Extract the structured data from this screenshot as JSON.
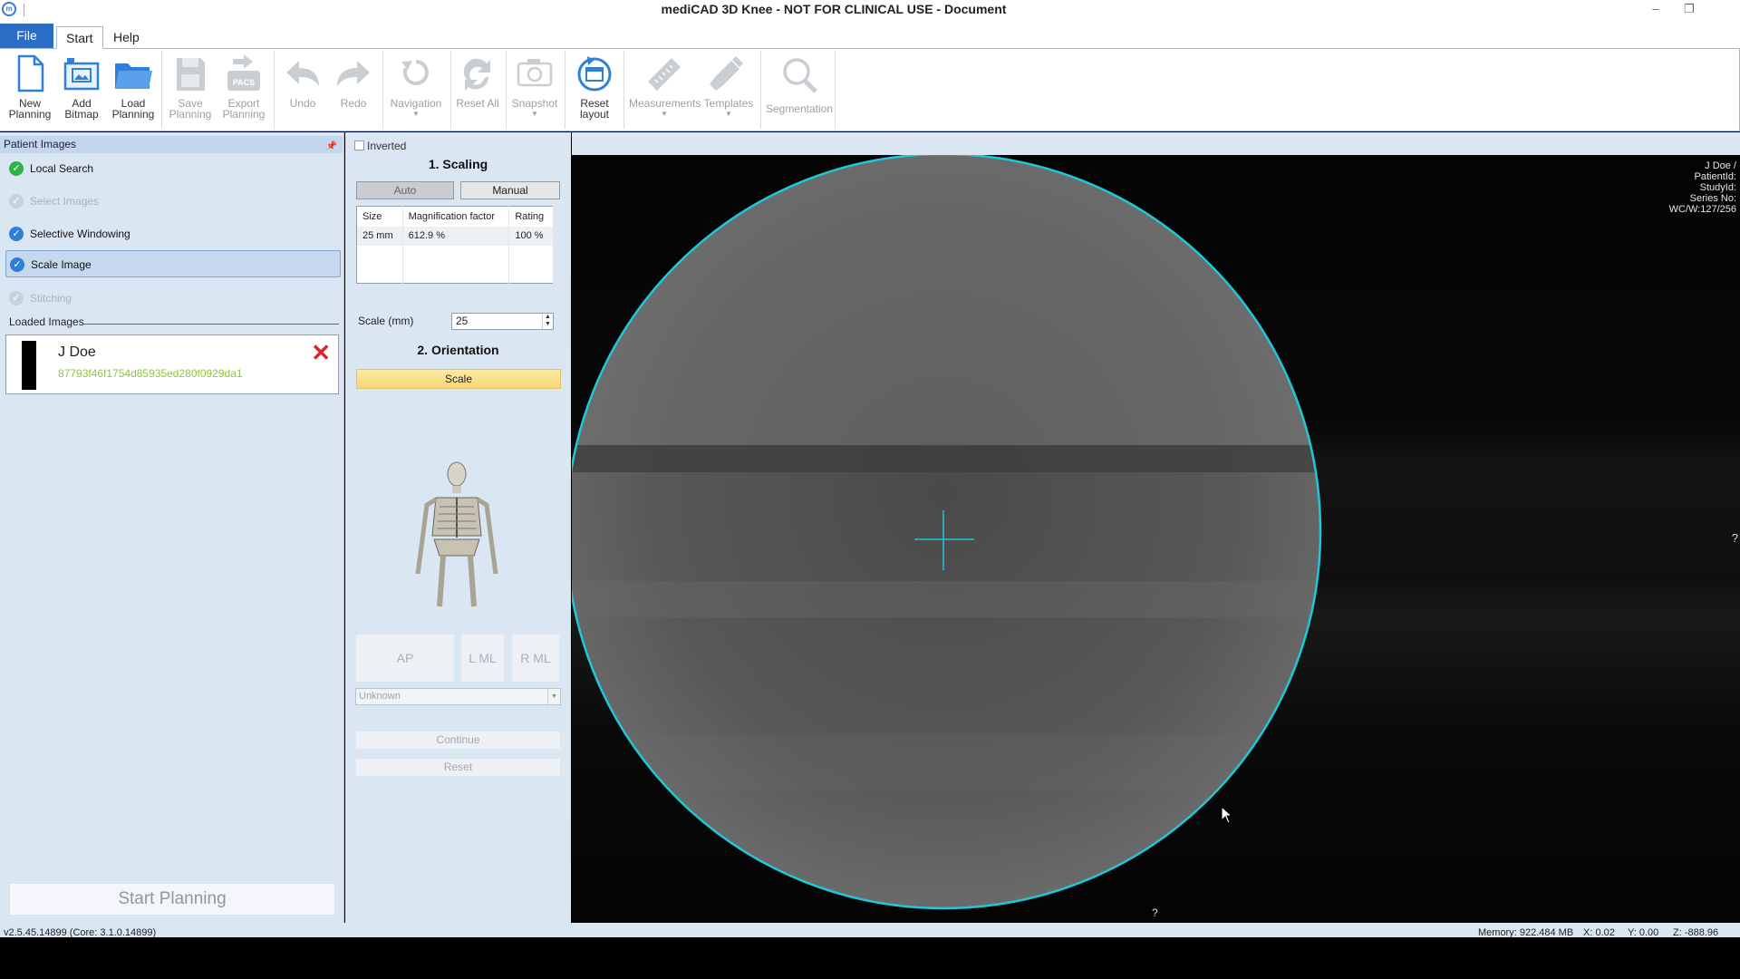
{
  "window": {
    "title": "mediCAD 3D Knee - NOT FOR CLINICAL USE - Document",
    "app_icon_label": "m"
  },
  "menu": {
    "file": "File",
    "tabs": [
      "Start",
      "Help"
    ]
  },
  "ribbon": {
    "buttons": [
      {
        "label1": "New",
        "label2": "Planning",
        "icon": "new-document-icon",
        "enabled": true
      },
      {
        "label1": "Add",
        "label2": "Bitmap",
        "icon": "add-bitmap-icon",
        "enabled": true
      },
      {
        "label1": "Load",
        "label2": "Planning",
        "icon": "folder-icon",
        "enabled": true
      },
      {
        "label1": "Save",
        "label2": "Planning",
        "icon": "save-icon",
        "enabled": false
      },
      {
        "label1": "Export",
        "label2": "Planning",
        "icon": "pacs-export-icon",
        "enabled": false
      },
      {
        "label1": "Undo",
        "label2": "",
        "icon": "undo-icon",
        "enabled": false
      },
      {
        "label1": "Redo",
        "label2": "",
        "icon": "redo-icon",
        "enabled": false
      },
      {
        "label1": "Navigation",
        "label2": "",
        "icon": "navigation-icon",
        "enabled": false
      },
      {
        "label1": "Reset All",
        "label2": "",
        "icon": "reset-all-icon",
        "enabled": false
      },
      {
        "label1": "Snapshot",
        "label2": "",
        "icon": "camera-icon",
        "enabled": false
      },
      {
        "label1": "Reset",
        "label2": "layout",
        "icon": "reset-layout-icon",
        "enabled": true
      },
      {
        "label1": "Measurements",
        "label2": "",
        "icon": "ruler-icon",
        "enabled": false
      },
      {
        "label1": "Templates",
        "label2": "",
        "icon": "implant-template-icon",
        "enabled": false
      },
      {
        "label1": "Segmentation",
        "label2": "",
        "icon": "magnifier-icon",
        "enabled": false
      }
    ],
    "pacs_badge": "PACS"
  },
  "left_panel": {
    "header": "Patient Images",
    "steps": [
      {
        "label": "Local Search",
        "state": "done"
      },
      {
        "label": "Select Images",
        "state": "disabled"
      },
      {
        "label": "Selective Windowing",
        "state": "checked"
      },
      {
        "label": "Scale Image",
        "state": "active"
      },
      {
        "label": "Stitching",
        "state": "disabled"
      }
    ],
    "loaded_images_label": "Loaded Images",
    "loaded_images": [
      {
        "name": "J Doe",
        "id": "87793f46f1754d85935ed280f0929da1"
      }
    ],
    "start_planning": "Start Planning"
  },
  "mid_panel": {
    "inverted_label": "Inverted",
    "inverted_checked": false,
    "scaling_title": "1. Scaling",
    "mode_auto": "Auto",
    "mode_manual": "Manual",
    "table": {
      "headers": [
        "Size",
        "Magnification factor",
        "Rating"
      ],
      "rows": [
        [
          "25 mm",
          "612.9 %",
          "100 %"
        ]
      ]
    },
    "scale_label": "Scale (mm)",
    "scale_value": "25",
    "scale_button": "Scale",
    "orientation_title": "2. Orientation",
    "orient_buttons": [
      "AP",
      "L ML",
      "R ML"
    ],
    "view_select": "Unknown",
    "continue": "Continue",
    "reset": "Reset"
  },
  "viewer": {
    "overlay": [
      "J Doe  /",
      "PatientId:",
      "StudyId:",
      "Series No:",
      "WC/W:127/256"
    ],
    "marker_right": "?",
    "marker_bottom": "?",
    "circle_color": "#1ec8d8"
  },
  "status": {
    "version": "v2.5.45.14899 (Core: 3.1.0.14899)",
    "memory": "Memory: 922.484 MB",
    "x": "X: 0.02",
    "y": "Y: 0.00",
    "z": "Z: -888.96"
  }
}
